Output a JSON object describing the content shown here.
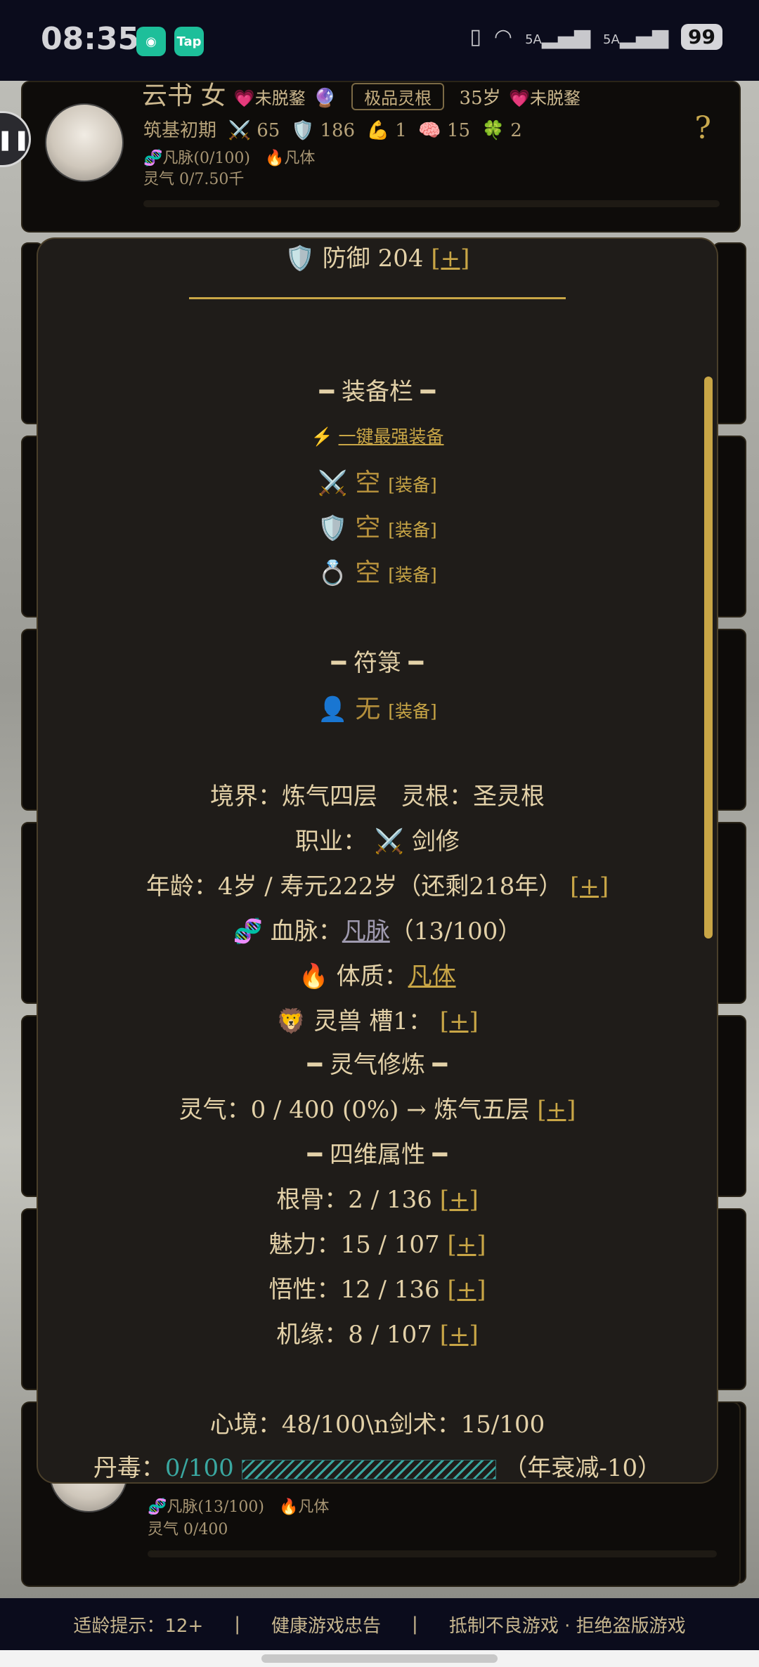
{
  "status_bar": {
    "time": "08:35",
    "app1_icon": "mi-app-icon",
    "app2_label": "Tap",
    "signal_5a_1": "5A",
    "signal_5a_2": "5A",
    "battery": "99"
  },
  "top_card": {
    "name": "云书 女",
    "tag_lostfetus_1": "未脱鍪",
    "root_tag": "极品灵根",
    "age": "35岁",
    "tag_lostfetus_2": "未脱鍪",
    "realm": "筑基初期",
    "attack": "65",
    "defense": "186",
    "strength": "1",
    "mind": "15",
    "luck": "2",
    "bloodline": "凡脉(0/100)",
    "physique": "凡体",
    "qi": "灵气 0/7.50千",
    "help_icon": "?"
  },
  "bottom_card": {
    "bloodline": "凡脉(13/100)",
    "physique": "凡体",
    "qi": "灵气 0/400"
  },
  "modal": {
    "defense_line": "防御 204",
    "plus": "[+]",
    "equip_header": "━ 装备栏 ━",
    "auto_equip": "一键最强装备",
    "slots": [
      {
        "icon": "sword-icon",
        "value": "空",
        "action": "[装备]"
      },
      {
        "icon": "shield-icon",
        "value": "空",
        "action": "[装备]"
      },
      {
        "icon": "ring-icon",
        "value": "空",
        "action": "[装备]"
      }
    ],
    "talisman_header": "━ 符箓 ━",
    "talisman": {
      "icon": "silhouette-icon",
      "value": "无",
      "action": "[装备]"
    },
    "realm_line": "境界：炼气四层　灵根：圣灵根",
    "job_prefix": "职业：",
    "job_value": "剑修",
    "age_line": "年龄：4岁 / 寿元222岁（还剩218年）",
    "bloodline_prefix": "血脉：",
    "bloodline_value": "凡脉",
    "bloodline_suffix": "（13/100）",
    "physique_prefix": "体质：",
    "physique_value": "凡体",
    "beast_line": "灵兽 槽1：",
    "qi_header": "━ 灵气修炼 ━",
    "qi_line": "灵气：0 / 400 (0%) → 炼气五层",
    "attr_header": "━ 四维属性 ━",
    "attributes": [
      {
        "label": "根骨：2 / 136"
      },
      {
        "label": "魅力：15 / 107"
      },
      {
        "label": "悟性：12 / 136"
      },
      {
        "label": "机缘：8 / 107"
      }
    ],
    "mind_line": "心境：48/100\\n剑术：15/100",
    "toxin_prefix": "丹毒：",
    "toxin_value": "0/100",
    "toxin_suffix": "（年衰减-10）"
  },
  "footer": {
    "age_hint": "适龄提示：12+",
    "sep1": "|",
    "health": "健康游戏忠告",
    "sep2": "|",
    "antipiracy": "抵制不良游戏 · 拒绝盗版游戏"
  }
}
